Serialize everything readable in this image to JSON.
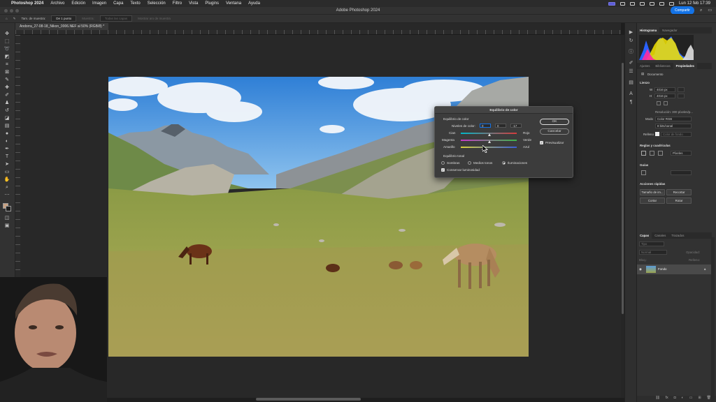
{
  "menubar": {
    "app": "Photoshop 2024",
    "items": [
      "Archivo",
      "Edición",
      "Imagen",
      "Capa",
      "Texto",
      "Selección",
      "Filtro",
      "Vista",
      "Plugins",
      "Ventana",
      "Ayuda"
    ],
    "clock": "Lun 12 feb 17:39"
  },
  "window": {
    "title": "Adobe Photoshop 2024",
    "share_label": "Compartir"
  },
  "options": {
    "sample_size_label": "Tam. de muestra:",
    "sample_size_value": "De 1 punto",
    "sample_label": "Muestra:",
    "sample_value": "Todas las capas",
    "show_ring": "Mostrar aro de muestra"
  },
  "document": {
    "tab": "Andorra_27-08-18_Nikon_0006.NEF al 50% (RGB/8) *"
  },
  "dialog": {
    "title": "Equilibrio de color",
    "section_color": "Equilibrio de color",
    "levels_label": "Niveles de color:",
    "levels": [
      "0",
      "0",
      "-17"
    ],
    "rows": [
      {
        "left": "Cian",
        "right": "Rojo",
        "pos": 0.5
      },
      {
        "left": "Magenta",
        "right": "Verde",
        "pos": 0.5
      },
      {
        "left": "Amarillo",
        "right": "Azul",
        "pos": 0.39
      }
    ],
    "section_tone": "Equilibrio tonal",
    "tones": [
      "Sombras",
      "Medios tonos",
      "Iluminaciones"
    ],
    "tone_selected": "Iluminaciones",
    "preserve": "Conservar luminosidad",
    "ok": "OK",
    "cancel": "Cancelar",
    "preview": "Previsualizar"
  },
  "panels": {
    "top_tabs": [
      "Histograma",
      "Navegador"
    ],
    "prop_tabs": [
      "Ajustes",
      "Bibliotecas",
      "Propiedades"
    ],
    "doc_label": "Documento",
    "canvas_title": "Lienzo",
    "width": "4016 px",
    "height": "4016 px",
    "resolution": "Resolución: 300 píxeles/p...",
    "mode_label": "Modo",
    "mode_value": "Color RGB",
    "bits_value": "8 bits/canal",
    "fill_label": "Relleno",
    "fill_value": "Color de fondo",
    "rulers_title": "Reglas y cuadrículas",
    "units_value": "Píxeles",
    "guides_title": "Guías",
    "quick_title": "Acciones rápidas",
    "quick_buttons": [
      "Tamaño de im...",
      "Recortar",
      "Cortar",
      "Rotar"
    ],
    "layer_tabs": [
      "Capas",
      "Canales",
      "Trazados"
    ],
    "layer_search": "Tipo",
    "blend": "Normal",
    "opacity_label": "Opacidad:",
    "lock_label": "Bloq.:",
    "fill2_label": "Relleno:",
    "layer_name": "Fondo"
  },
  "colors": {
    "accent": "#1473e6",
    "panel_bg": "#323232",
    "canvas_bg": "#282828"
  }
}
